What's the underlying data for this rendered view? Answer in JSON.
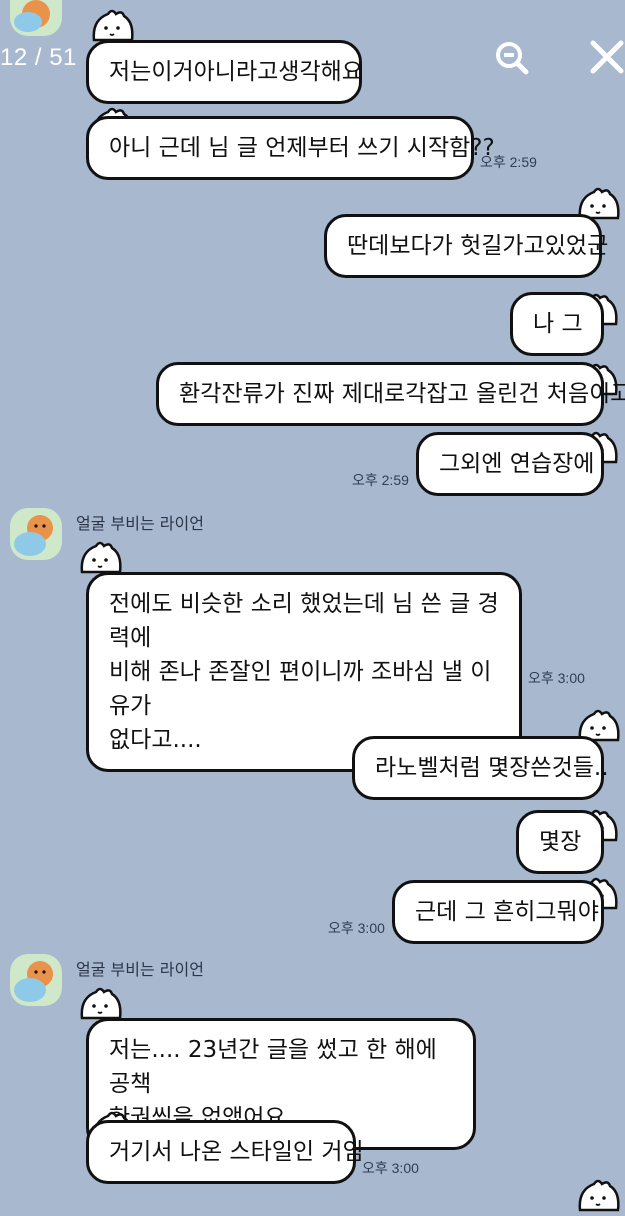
{
  "viewer": {
    "counter": "12 / 51",
    "zoom_icon": "zoom-out-icon",
    "close_icon": "close-icon"
  },
  "chat": {
    "sender_name": "얼굴 부비는 라이언",
    "messages": [
      {
        "id": "m1",
        "side": "left",
        "text": "저는이거아니라고생각해요"
      },
      {
        "id": "m2",
        "side": "left",
        "text": "아니 근데 님 글 언제부터 쓰기 시작함??",
        "time": "오후 2:59"
      },
      {
        "id": "m3",
        "side": "right",
        "text": "딴데보다가 헛길가고있었군"
      },
      {
        "id": "m4",
        "side": "right",
        "text": "나 그"
      },
      {
        "id": "m5",
        "side": "right",
        "text": "환각잔류가 진짜 제대로각잡고 올린건 처음이고"
      },
      {
        "id": "m6",
        "side": "right",
        "text": "그외엔 연습장에",
        "time": "오후 2:59"
      },
      {
        "id": "m7",
        "side": "left",
        "lines": [
          "전에도 비슷한 소리 했었는데 님 쓴 글 경력에",
          "비해 존나 존잘인 편이니까 조바심 낼 이유가",
          "없다고...."
        ],
        "time": "오후 3:00"
      },
      {
        "id": "m8",
        "side": "right",
        "text": "라노벨처럼 몇장쓴것들.."
      },
      {
        "id": "m9",
        "side": "right",
        "text": "몇장"
      },
      {
        "id": "m10",
        "side": "right",
        "text": "근데 그 흔히그뭐야",
        "time": "오후 3:00"
      },
      {
        "id": "m11",
        "side": "left",
        "lines": [
          "저는.... 23년간 글을 썼고 한 해에 공책",
          "한권씩을 없앴어요"
        ]
      },
      {
        "id": "m12",
        "side": "left",
        "text": "거기서 나온 스타일인 거임",
        "time": "오후 3:00"
      }
    ]
  },
  "colors": {
    "background": "#a7b8cf",
    "bubble": "#ffffff",
    "outline": "#111111"
  }
}
